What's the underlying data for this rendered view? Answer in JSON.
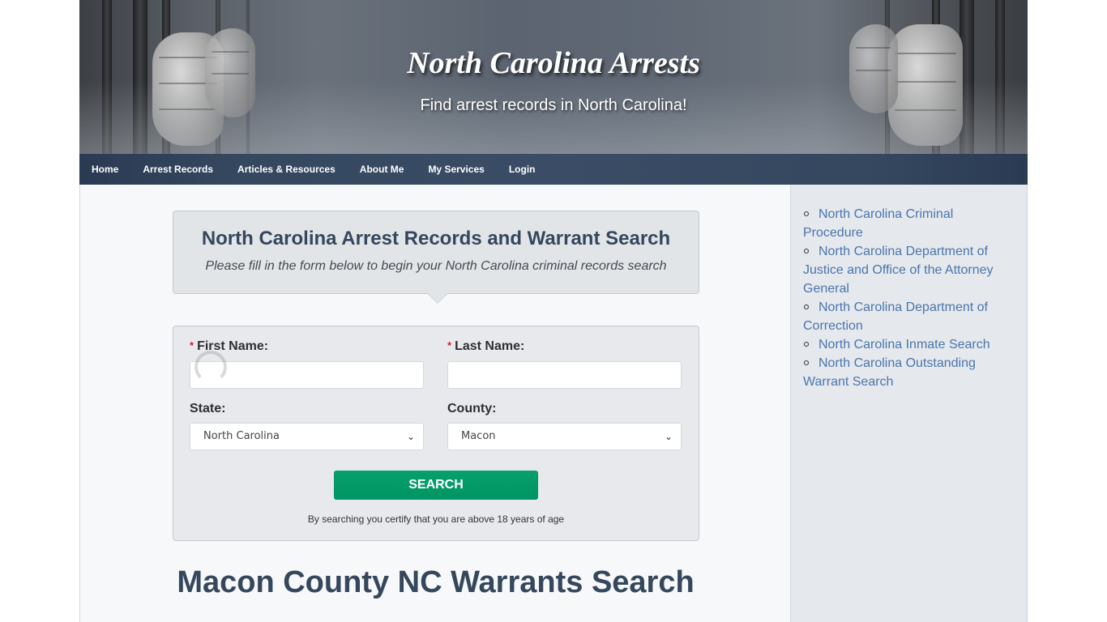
{
  "header": {
    "title": "North Carolina Arrests",
    "tagline": "Find arrest records in North Carolina!"
  },
  "nav": {
    "items": [
      {
        "label": "Home"
      },
      {
        "label": "Arrest Records"
      },
      {
        "label": "Articles & Resources"
      },
      {
        "label": "About Me"
      },
      {
        "label": "My Services"
      },
      {
        "label": "Login"
      }
    ]
  },
  "intro": {
    "title": "North Carolina Arrest Records and Warrant Search",
    "subtitle": "Please fill in the form below to begin your North Carolina criminal records search"
  },
  "form": {
    "required_marker": "*",
    "first_name_label": "First Name:",
    "first_name_value": "",
    "last_name_label": "Last Name:",
    "last_name_value": "",
    "state_label": "State:",
    "state_value": "North Carolina",
    "county_label": "County:",
    "county_value": "Macon",
    "search_label": "SEARCH",
    "disclaimer": "By searching you certify that you are above 18 years of age"
  },
  "page_heading": "Macon County NC Warrants Search",
  "sidebar": {
    "links": [
      {
        "label": "North Carolina Criminal Procedure"
      },
      {
        "label": "North Carolina Department of Justice and Office of the Attorney General"
      },
      {
        "label": "North Carolina Department of Correction"
      },
      {
        "label": "North Carolina Inmate Search"
      },
      {
        "label": "North Carolina Outstanding Warrant Search"
      }
    ]
  },
  "colors": {
    "nav_bg": "#34475f",
    "heading": "#35475c",
    "link": "#4a76ad",
    "search_button": "#009563",
    "required": "#d9232d"
  },
  "icons": {
    "select_chevron": "chevron-down-icon",
    "list_bullet": "circle-bullet-icon"
  }
}
